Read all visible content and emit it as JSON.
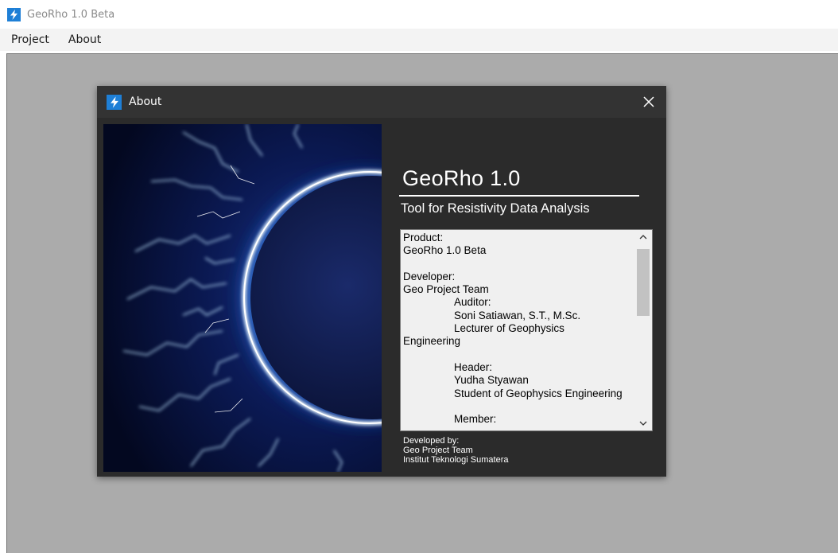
{
  "window": {
    "title": "GeoRho 1.0 Beta",
    "icon": "lightning-bolt-icon"
  },
  "menu": {
    "items": [
      {
        "label": "Project"
      },
      {
        "label": "About"
      }
    ]
  },
  "about_dialog": {
    "title": "About",
    "close_icon": "close-icon",
    "product_name": "GeoRho 1.0",
    "tagline": "Tool for Resistivity Data Analysis",
    "info_lines": [
      "Product:",
      "GeoRho 1.0 Beta",
      "",
      "Developer:",
      "Geo Project Team",
      "Auditor:",
      "Soni Satiawan, S.T., M.Sc.",
      "Lecturer of Geophysics",
      "Engineering",
      "",
      "Header:",
      "Yudha Styawan",
      "Student of Geophysics Engineering",
      "",
      "Member:"
    ],
    "credits": {
      "line1": "Developed by:",
      "line2": "Geo Project Team",
      "line3": "Institut Teknologi Sumatera"
    }
  },
  "colors": {
    "accent": "#1e7fd6",
    "dialog_bg": "#2b2b2b",
    "client_bg": "#ababab"
  }
}
